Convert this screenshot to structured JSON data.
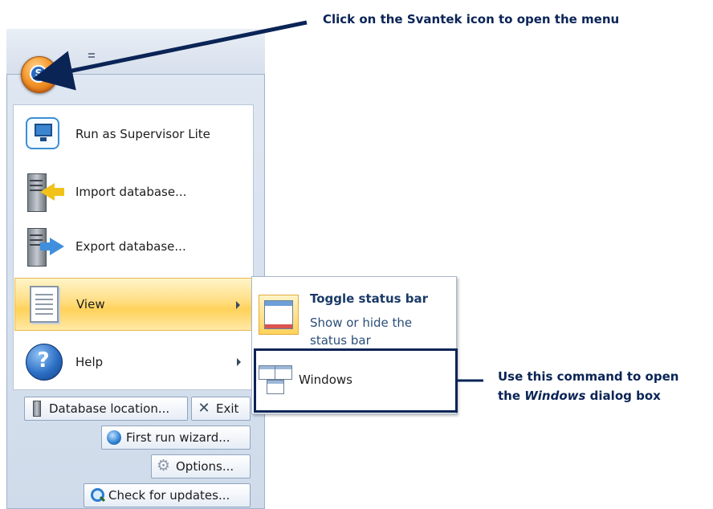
{
  "annotations": {
    "top": "Click on the Svantek icon to open the menu",
    "right_line1": "Use this command to open",
    "right_line2_prefix": "the ",
    "right_line2_em": "Windows",
    "right_line2_suffix": " dialog box"
  },
  "menu": {
    "items": [
      {
        "label": "Run as Supervisor Lite",
        "icon": "monitor-icon"
      },
      {
        "label": "Import database...",
        "icon": "import-database-icon"
      },
      {
        "label": "Export database...",
        "icon": "export-database-icon"
      },
      {
        "label": "View",
        "icon": "document-view-icon",
        "active": true
      },
      {
        "label": "Help",
        "icon": "help-icon"
      }
    ],
    "bottom_buttons": [
      {
        "label": "Database location...",
        "icon": "database-icon"
      },
      {
        "label": "Exit",
        "icon": "close-icon"
      },
      {
        "label": "First run wizard...",
        "icon": "wizard-icon"
      },
      {
        "label": "Options...",
        "icon": "gear-icon"
      },
      {
        "label": "Check for updates...",
        "icon": "search-icon"
      }
    ]
  },
  "submenu": {
    "toggle": {
      "title": "Toggle status bar",
      "description": "Show or hide the status bar"
    },
    "windows": {
      "label": "Windows"
    }
  },
  "colors": {
    "annotation": "#0a2456",
    "highlight": "#ffd25a",
    "orb": "#f59a2e"
  }
}
